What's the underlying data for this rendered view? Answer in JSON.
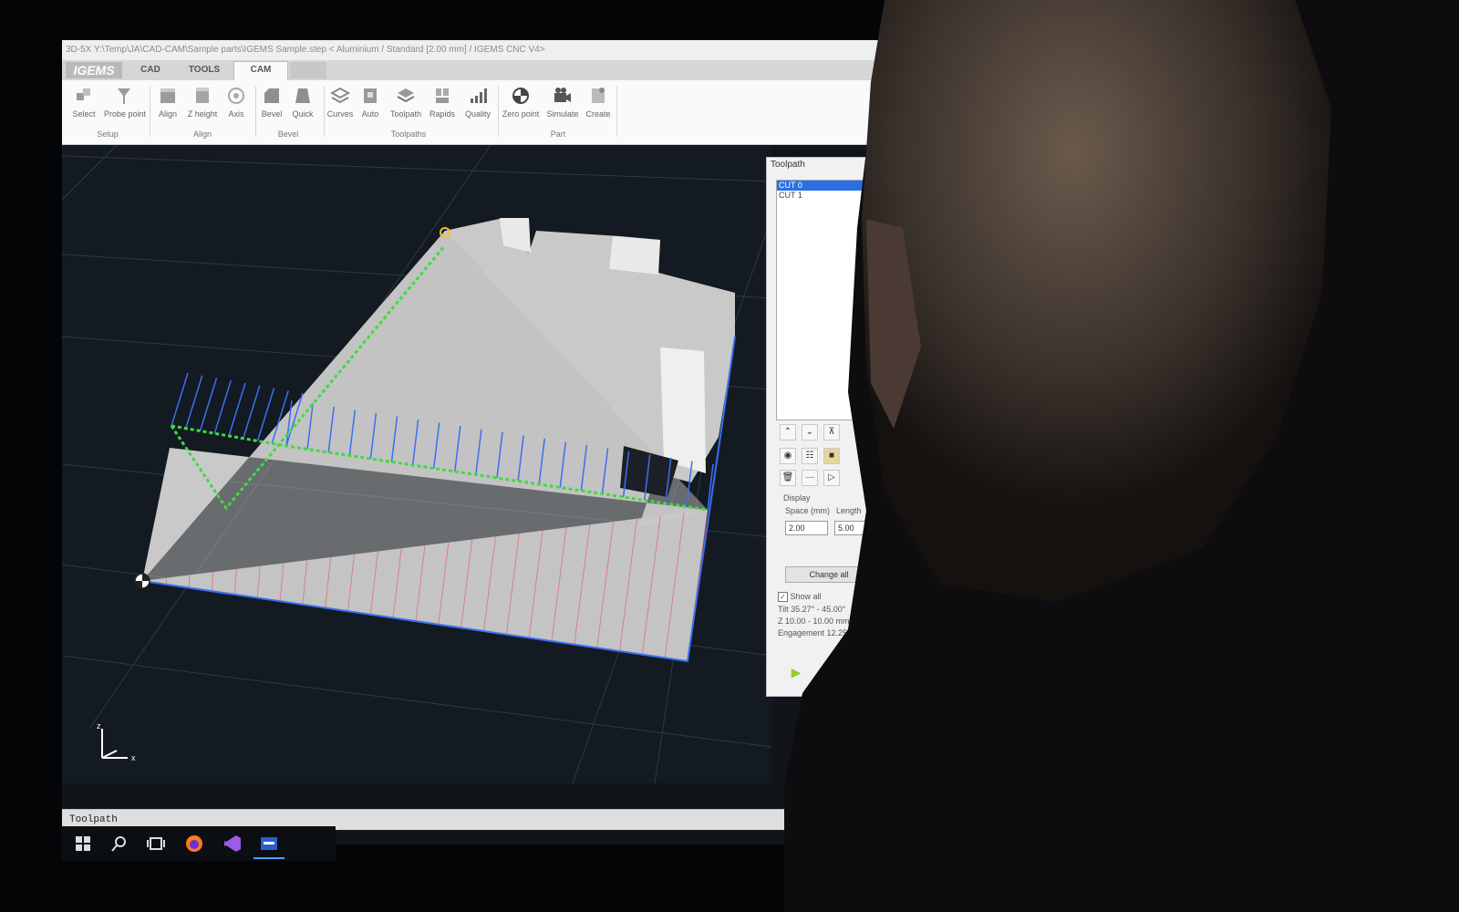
{
  "window": {
    "title": "3D-5X  Y:\\Temp\\JA\\CAD-CAM\\Sample parts\\IGEMS Sample.step  < Aluminium / Standard [2.00 mm] / IGEMS CNC V4>"
  },
  "ribbon": {
    "logo": "IGEMS",
    "tabs": [
      "CAD",
      "TOOLS",
      "CAM"
    ],
    "active_tab": "CAM",
    "buttons": {
      "select": "Select",
      "probe_point": "Probe point",
      "align": "Align",
      "z_height": "Z height",
      "axis": "Axis",
      "bevel": "Bevel",
      "quick": "Quick",
      "curves": "Curves",
      "auto": "Auto",
      "toolpath": "Toolpath",
      "rapids": "Rapids",
      "quality": "Quality",
      "zero_point": "Zero point",
      "simulate": "Simulate",
      "create": "Create"
    },
    "groups": {
      "setup": "Setup",
      "align": "Align",
      "bevel": "Bevel",
      "toolpaths": "Toolpaths",
      "part": "Part"
    }
  },
  "panel": {
    "title": "Toolpath",
    "cuts": [
      "CUT 0",
      "CUT 1"
    ],
    "selected_cut": "CUT 0",
    "display_label": "Display",
    "space_label": "Space (mm)",
    "length_label": "Length",
    "space_value": "2.00",
    "length_value": "5.00",
    "change_all": "Change all",
    "show_all": "Show all",
    "show_all_checked": true,
    "tilt": "Tilt 35.27° - 45.00°",
    "z": "Z 10.00 - 10.00 mm",
    "engagement": "Engagement 12.25 - 14.14 mm"
  },
  "status": {
    "text": "Toolpath"
  },
  "colors": {
    "viewport_bg": "#131a21",
    "part_face": "#bdbdbd",
    "toolpath_green": "#3fdc3f",
    "tool_vector_blue": "#3b6ff2",
    "cut_line_red": "#e06a6a",
    "selection_blue": "#2b6ee6"
  },
  "icons": {
    "taskbar": [
      "windows-start-icon",
      "search-icon",
      "task-view-icon",
      "firefox-icon",
      "visual-studio-icon",
      "igems-app-icon"
    ]
  }
}
